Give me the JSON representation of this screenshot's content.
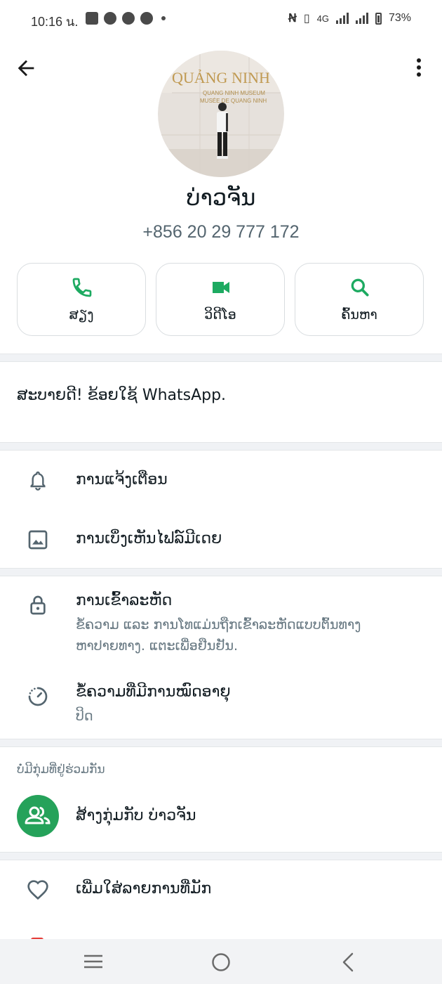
{
  "status_bar": {
    "time": "10:16 น.",
    "network": "4G",
    "battery": "73%",
    "left_icons": [
      "mail-icon",
      "check-circle-icon",
      "chat-bubble-icon",
      "check-circle-icon"
    ],
    "right_icons": [
      "nfc-icon",
      "vibrate-icon",
      "signal-icon",
      "signal-icon",
      "battery-icon"
    ]
  },
  "header": {
    "back_icon": "arrow-back-icon",
    "menu_icon": "more-vertical-icon"
  },
  "profile": {
    "name": "ບ່າວຈັນ",
    "phone": "+856 20 29 777 172",
    "photo_text": {
      "line1": "QUẢNG NINH",
      "line2": "QUANG NINH MUSEUM",
      "line3": "MUSÉE DE QUANG NINH"
    }
  },
  "actions": [
    {
      "label": "ສຽງ",
      "icon": "phone-icon"
    },
    {
      "label": "ວິດີໂອ",
      "icon": "video-camera-icon"
    },
    {
      "label": "ຄົ້ນຫາ",
      "icon": "search-icon"
    }
  ],
  "about": {
    "text": "ສະບາຍດີ! ຂ້ອຍໃຊ້ WhatsApp."
  },
  "settings": [
    {
      "title": "ການແຈ້ງເຕືອນ",
      "icon": "bell-icon"
    },
    {
      "title": "ການເບິ່ງເຫັນໄຟລ໌ມີເດຍ",
      "icon": "image-icon"
    }
  ],
  "privacy": {
    "encryption": {
      "title": "ການເຂົ້າລະຫັດ",
      "line1": "ຂໍ້ຄວາມ ແລະ ການໂທແມ່ນຖືກເຂົ້າລະຫັດແບບຕົ້ນທາງ",
      "line2": "ຫາປາຍທາງ. ແຕະເພື່ອຢືນຢັນ.",
      "icon": "lock-icon"
    },
    "disappearing": {
      "title": "ຂໍ້ຄວາມທີ່ມີການໝົດອາຍຸ",
      "subtitle": "ປິດ",
      "icon": "timer-icon"
    }
  },
  "groups": {
    "section_label": "ບໍ່ມີກຸ່ມທີ່ຢູ່ຮ່ວມກັນ",
    "create_label": "ສ້າງກຸ່ມກັບ ບ່າວຈັນ",
    "icon": "group-icon",
    "accent": "#25a25a"
  },
  "favorites": {
    "label": "ເພີ່ມໃສ່ລາຍການທີ່ມັກ",
    "icon": "heart-icon"
  },
  "nav_bar": {
    "icons": [
      "recent-apps-icon",
      "home-icon",
      "back-icon"
    ]
  },
  "colors": {
    "accent_green": "#1daa61",
    "text_primary": "#111b21",
    "text_secondary": "#667781",
    "divider": "#f0f2f5"
  }
}
